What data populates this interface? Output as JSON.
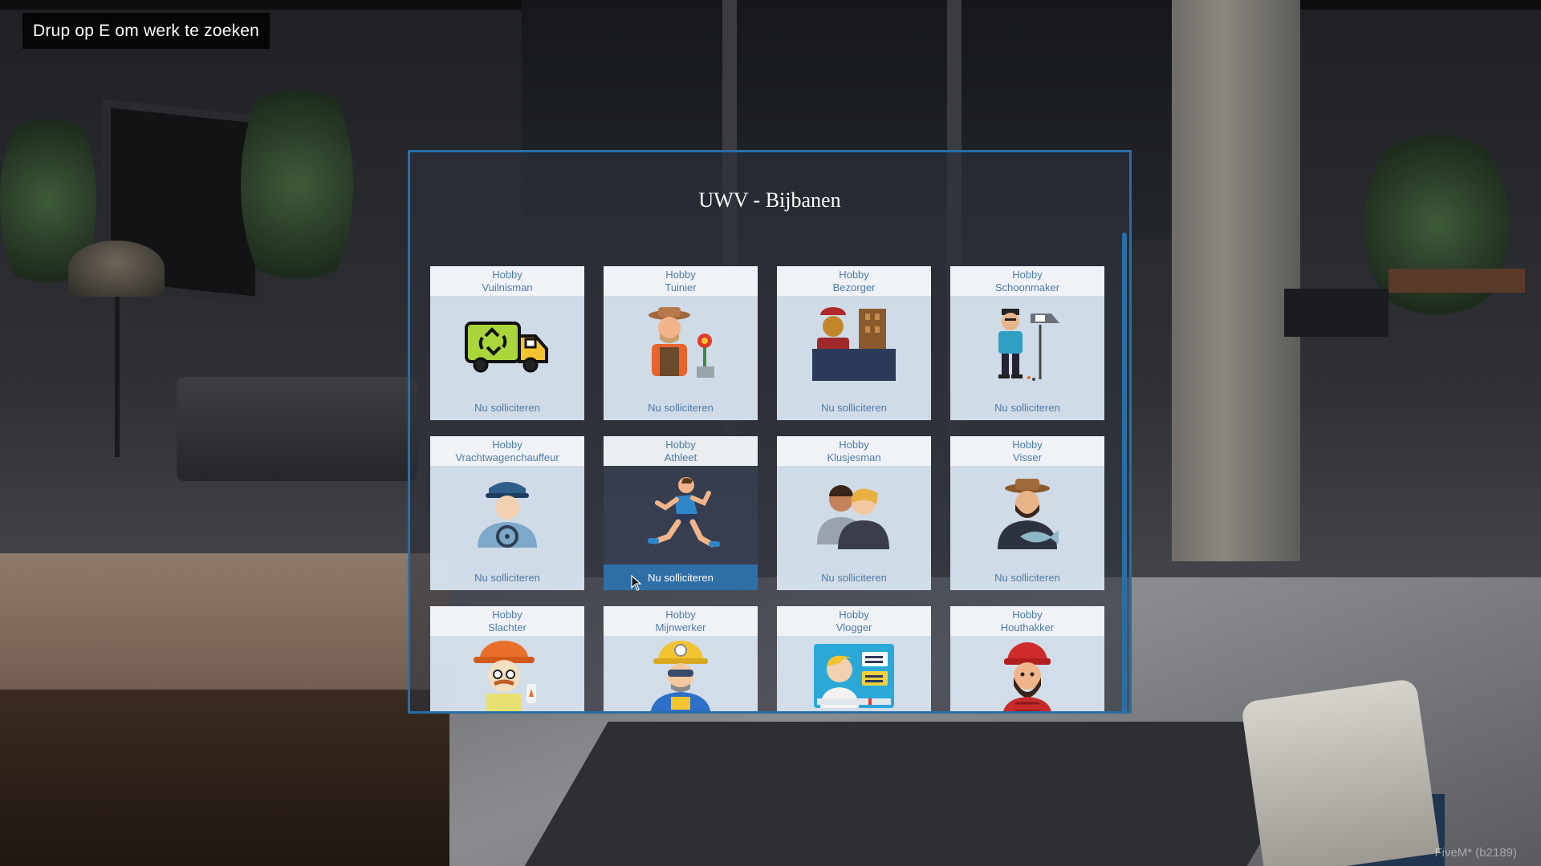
{
  "hint": {
    "text": "Drup op E om werk te zoeken"
  },
  "panel": {
    "title": "UWV - Bijbanen"
  },
  "jobs": [
    {
      "category": "Hobby",
      "name": "Vuilnisman",
      "action": "Nu solliciteren",
      "icon": "garbage-truck-icon"
    },
    {
      "category": "Hobby",
      "name": "Tuinier",
      "action": "Nu solliciteren",
      "icon": "gardener-icon"
    },
    {
      "category": "Hobby",
      "name": "Bezorger",
      "action": "Nu solliciteren",
      "icon": "delivery-person-icon"
    },
    {
      "category": "Hobby",
      "name": "Schoonmaker",
      "action": "Nu solliciteren",
      "icon": "cleaner-icon"
    },
    {
      "category": "Hobby",
      "name": "Vrachtwagenchauffeur",
      "action": "Nu solliciteren",
      "icon": "truck-driver-icon"
    },
    {
      "category": "Hobby",
      "name": "Athleet",
      "action": "Nu solliciteren",
      "icon": "runner-icon"
    },
    {
      "category": "Hobby",
      "name": "Klusjesman",
      "action": "Nu solliciteren",
      "icon": "handyman-icon"
    },
    {
      "category": "Hobby",
      "name": "Visser",
      "action": "Nu solliciteren",
      "icon": "fisherman-icon"
    },
    {
      "category": "Hobby",
      "name": "Slachter",
      "icon": "butcher-icon"
    },
    {
      "category": "Hobby",
      "name": "Mijnwerker",
      "icon": "miner-icon"
    },
    {
      "category": "Hobby",
      "name": "Vlogger",
      "icon": "vlogger-icon"
    },
    {
      "category": "Hobby",
      "name": "Houthakker",
      "icon": "lumberjack-icon"
    }
  ],
  "watermark": {
    "text": "FiveM* (b2189)"
  }
}
